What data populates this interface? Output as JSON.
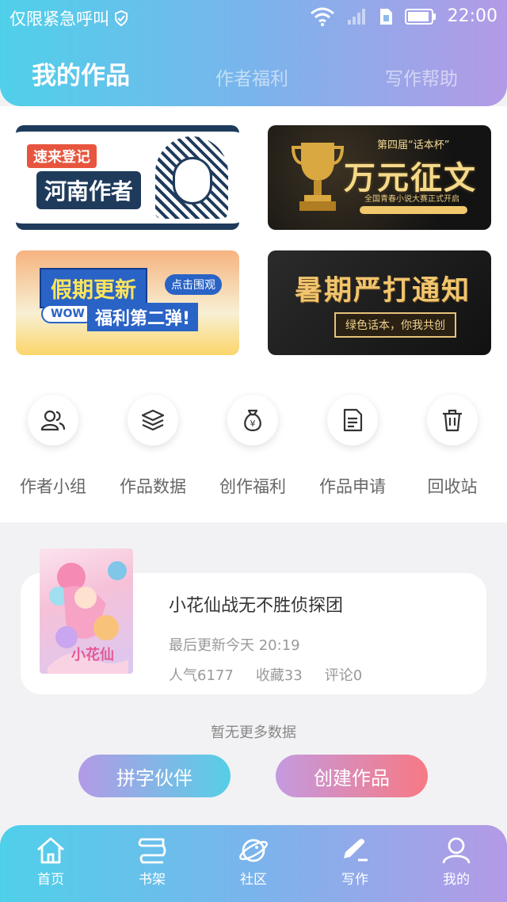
{
  "status_bar": {
    "emergency_text": "仅限紧急呼叫",
    "time": "22:00"
  },
  "tabs": [
    {
      "label": "我的作品",
      "active": true
    },
    {
      "label": "作者福利",
      "active": false
    },
    {
      "label": "写作帮助",
      "active": false
    }
  ],
  "banners": [
    {
      "tag": "速来登记",
      "title": "河南作者"
    },
    {
      "small": "第四届“话本杯”",
      "title": "万元征文",
      "sub": "全国青春小说大赛正式开启"
    },
    {
      "title": "假期更新",
      "badge": "点击围观",
      "wow": "WOW",
      "sub": "福利第二弹!"
    },
    {
      "title": "暑期严打通知",
      "pill": "绿色话本，你我共创"
    }
  ],
  "quick_actions": [
    {
      "label": "作者小组",
      "icon": "group-icon"
    },
    {
      "label": "作品数据",
      "icon": "layers-icon"
    },
    {
      "label": "创作福利",
      "icon": "money-bag-icon"
    },
    {
      "label": "作品申请",
      "icon": "document-icon"
    },
    {
      "label": "回收站",
      "icon": "trash-icon"
    }
  ],
  "work": {
    "title": "小花仙战无不胜侦探团",
    "updated": "最后更新今天 20:19",
    "popularity": "人气6177",
    "favorites": "收藏33",
    "comments": "评论0"
  },
  "no_more": "暂无更多数据",
  "buttons": {
    "partner": "拼字伙伴",
    "create": "创建作品"
  },
  "bottom_nav": [
    {
      "label": "首页",
      "icon": "home-icon"
    },
    {
      "label": "书架",
      "icon": "bookshelf-icon"
    },
    {
      "label": "社区",
      "icon": "planet-icon"
    },
    {
      "label": "写作",
      "icon": "pen-icon",
      "active": true
    },
    {
      "label": "我的",
      "icon": "profile-icon"
    }
  ],
  "colors": {
    "gradient_start": "#4fd0ea",
    "gradient_end": "#b49ae6",
    "create_end": "#f77984"
  }
}
